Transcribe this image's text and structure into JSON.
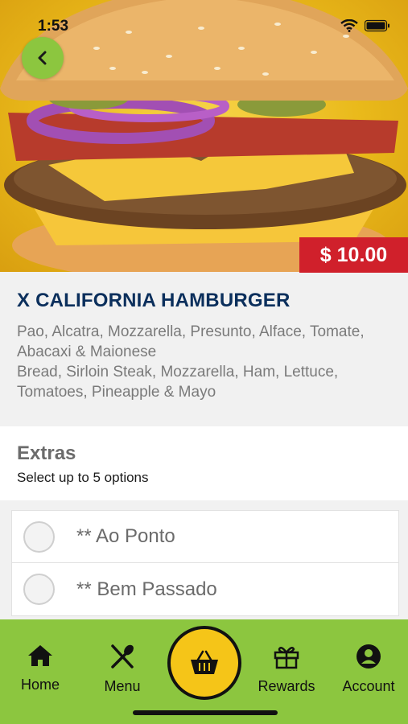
{
  "status_bar": {
    "time": "1:53"
  },
  "product": {
    "price": "$ 10.00",
    "name": "X CALIFORNIA HAMBURGER",
    "description_pt": "Pao, Alcatra, Mozzarella, Presunto, Alface, Tomate, Abacaxi & Maionese",
    "description_en": "Bread, Sirloin Steak, Mozzarella, Ham, Lettuce, Tomatoes, Pineapple & Mayo"
  },
  "extras": {
    "title": "Extras",
    "subtitle": "Select up to 5 options",
    "options": [
      {
        "label": "** Ao Ponto",
        "selected": false
      },
      {
        "label": "** Bem Passado",
        "selected": false
      }
    ]
  },
  "tabbar": {
    "items": [
      {
        "label": "Home",
        "icon": "home-icon"
      },
      {
        "label": "Menu",
        "icon": "utensils-icon"
      },
      {
        "label": "Rewards",
        "icon": "gift-icon"
      },
      {
        "label": "Account",
        "icon": "account-icon"
      }
    ],
    "cart_icon": "basket-icon"
  },
  "colors": {
    "accent_green": "#8cc63f",
    "price_red": "#d0202b",
    "title_navy": "#0b2f5c",
    "cart_yellow": "#f5c518"
  }
}
